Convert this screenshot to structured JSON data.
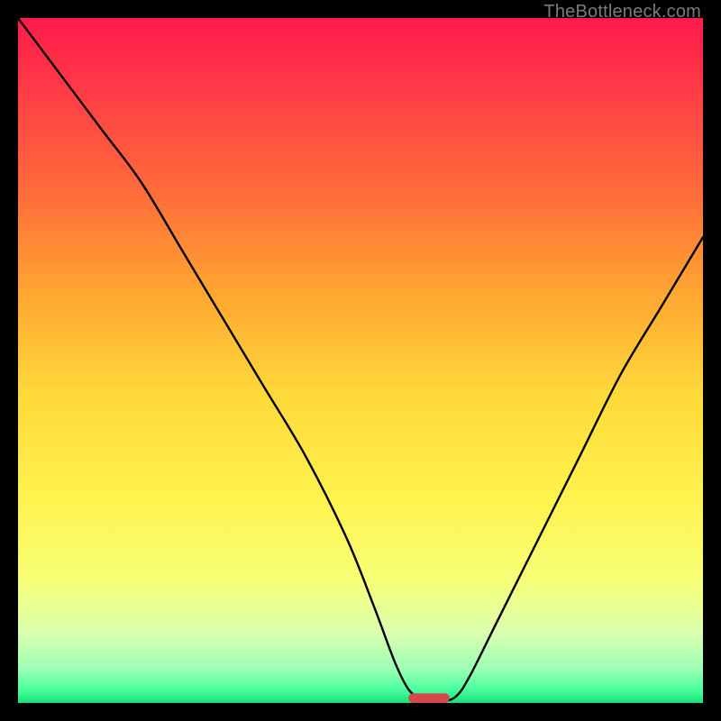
{
  "watermark": "TheBottleneck.com",
  "chart_data": {
    "type": "line",
    "title": "",
    "xlabel": "",
    "ylabel": "",
    "xlim": [
      0,
      100
    ],
    "ylim": [
      0,
      100
    ],
    "grid": false,
    "legend": false,
    "background_gradient": {
      "stops": [
        {
          "pos": 0.0,
          "color": "#ff1a4b"
        },
        {
          "pos": 0.1,
          "color": "#ff3a46"
        },
        {
          "pos": 0.25,
          "color": "#ff6a3a"
        },
        {
          "pos": 0.4,
          "color": "#ffa531"
        },
        {
          "pos": 0.55,
          "color": "#ffd93a"
        },
        {
          "pos": 0.7,
          "color": "#fff24d"
        },
        {
          "pos": 0.82,
          "color": "#f7ff77"
        },
        {
          "pos": 0.9,
          "color": "#d9ffb0"
        },
        {
          "pos": 0.95,
          "color": "#9cffb5"
        },
        {
          "pos": 0.98,
          "color": "#4bff9e"
        },
        {
          "pos": 1.0,
          "color": "#18e07a"
        }
      ]
    },
    "series": [
      {
        "name": "bottleneck-curve",
        "color": "#000000",
        "x": [
          0,
          6,
          12,
          18,
          24,
          30,
          36,
          42,
          48,
          52,
          55,
          57,
          59,
          60,
          62,
          64,
          66,
          70,
          76,
          82,
          88,
          94,
          100
        ],
        "y": [
          100,
          92,
          84,
          76,
          66,
          56,
          46,
          36,
          24,
          14,
          6,
          2,
          0.3,
          0,
          0.2,
          1,
          4,
          12,
          24,
          36,
          48,
          58,
          68
        ]
      }
    ],
    "marker": {
      "name": "optimal-marker",
      "color": "#d5474a",
      "x": 60,
      "y": 0,
      "width_x": 6,
      "height_y": 1.4
    }
  }
}
